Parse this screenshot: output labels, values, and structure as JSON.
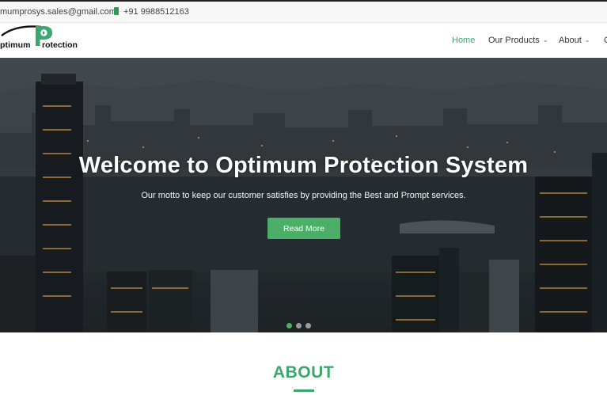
{
  "contact": {
    "email": "mumprosys.sales@gmail.com",
    "phone": "+91 9988512163"
  },
  "logo": {
    "text_part1": "ptimum",
    "text_part2": "rotection",
    "letter": "P"
  },
  "nav": {
    "items": [
      {
        "label": "Home",
        "active": true
      },
      {
        "label": "Our Products",
        "has_dropdown": true
      },
      {
        "label": "About",
        "has_dropdown": true
      },
      {
        "label": "C"
      }
    ]
  },
  "hero": {
    "title": "Welcome to Optimum Protection System",
    "motto": "Our motto to keep our customer satisfies by providing the Best and Prompt services.",
    "button_label": "Read More",
    "slides": 3,
    "active_slide": 1
  },
  "about": {
    "title": "ABOUT"
  },
  "colors": {
    "accent_green": "#3aa76d",
    "button_green": "#4caf68",
    "text_dark": "#333333"
  }
}
